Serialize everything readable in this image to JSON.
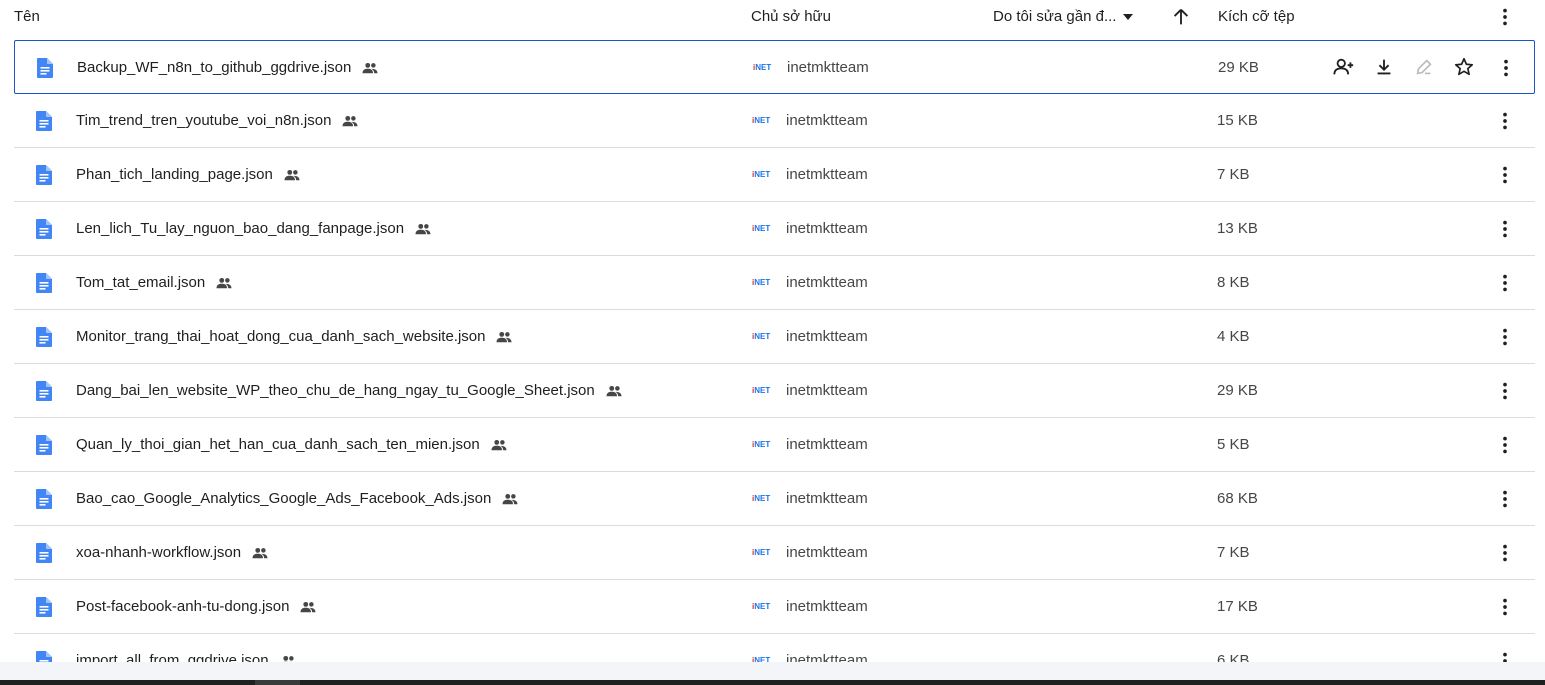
{
  "header": {
    "name": "Tên",
    "owner": "Chủ sở hữu",
    "modified": "Do tôi sửa gần đ...",
    "size": "Kích cỡ tệp"
  },
  "owner_logo_text": "iNET",
  "files": [
    {
      "name": "Backup_WF_n8n_to_github_ggdrive.json",
      "owner": "inetmktteam",
      "size": "29 KB"
    },
    {
      "name": "Tim_trend_tren_youtube_voi_n8n.json",
      "owner": "inetmktteam",
      "size": "15 KB"
    },
    {
      "name": "Phan_tich_landing_page.json",
      "owner": "inetmktteam",
      "size": "7 KB"
    },
    {
      "name": "Len_lich_Tu_lay_nguon_bao_dang_fanpage.json",
      "owner": "inetmktteam",
      "size": "13 KB"
    },
    {
      "name": "Tom_tat_email.json",
      "owner": "inetmktteam",
      "size": "8 KB"
    },
    {
      "name": "Monitor_trang_thai_hoat_dong_cua_danh_sach_website.json",
      "owner": "inetmktteam",
      "size": "4 KB"
    },
    {
      "name": "Dang_bai_len_website_WP_theo_chu_de_hang_ngay_tu_Google_Sheet.json",
      "owner": "inetmktteam",
      "size": "29 KB"
    },
    {
      "name": "Quan_ly_thoi_gian_het_han_cua_danh_sach_ten_mien.json",
      "owner": "inetmktteam",
      "size": "5 KB"
    },
    {
      "name": "Bao_cao_Google_Analytics_Google_Ads_Facebook_Ads.json",
      "owner": "inetmktteam",
      "size": "68 KB"
    },
    {
      "name": "xoa-nhanh-workflow.json",
      "owner": "inetmktteam",
      "size": "7 KB"
    },
    {
      "name": "Post-facebook-anh-tu-dong.json",
      "owner": "inetmktteam",
      "size": "17 KB"
    },
    {
      "name": "import_all_from_ggdrive.json",
      "owner": "inetmktteam",
      "size": "6 KB"
    }
  ],
  "colors": {
    "accent": "#1a56c8",
    "doc_icon": "#4285f4",
    "logo_red": "#d93025",
    "logo_blue": "#1a73e8"
  }
}
